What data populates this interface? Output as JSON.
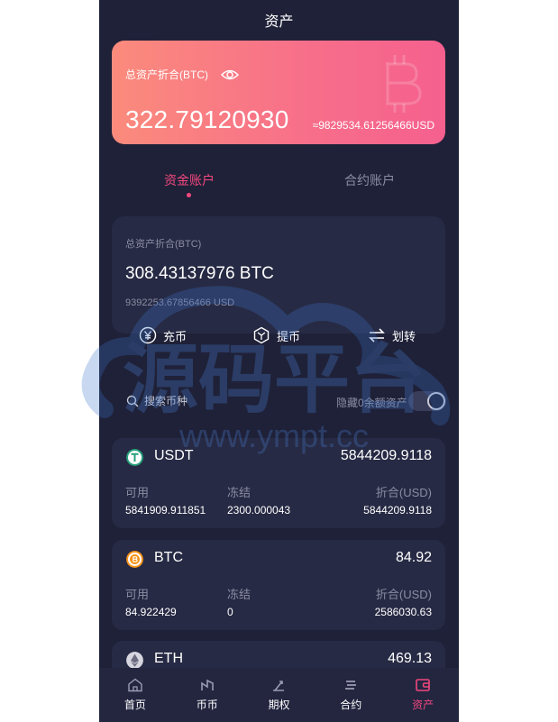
{
  "header": {
    "title": "资产"
  },
  "hero": {
    "label": "总资产折合(BTC)",
    "total": "322.79120930",
    "usd": "≈9829534.61256466USD",
    "eye_icon": "eye-icon"
  },
  "tabs": [
    {
      "label": "资金账户",
      "active": true
    },
    {
      "label": "合约账户",
      "active": false
    }
  ],
  "account": {
    "label": "总资产折合(BTC)",
    "btc": "308.43137976 BTC",
    "usd": "9392253.67856466 USD"
  },
  "actions": [
    {
      "label": "充币",
      "icon": "yen-circle-icon"
    },
    {
      "label": "提币",
      "icon": "hexagon-icon"
    },
    {
      "label": "划转",
      "icon": "transfer-icon"
    }
  ],
  "search": {
    "placeholder": "搜索币种",
    "hide_zero_label": "隐藏0余额资产"
  },
  "coins": [
    {
      "name": "USDT",
      "amount": "5844209.9118",
      "h_avail": "可用",
      "h_frozen": "冻结",
      "h_value": "折合(USD)",
      "avail": "5841909.911851",
      "frozen": "2300.000043",
      "value": "5844209.9118",
      "icon_color": "#26a17b"
    },
    {
      "name": "BTC",
      "amount": "84.92",
      "h_avail": "可用",
      "h_frozen": "冻结",
      "h_value": "折合(USD)",
      "avail": "84.922429",
      "frozen": "0",
      "value": "2586030.63",
      "icon_color": "#f7931a"
    },
    {
      "name": "ETH",
      "amount": "469.13"
    }
  ],
  "nav": [
    {
      "label": "首页",
      "icon": "home-icon",
      "active": false
    },
    {
      "label": "币币",
      "icon": "coin-trade-icon",
      "active": false
    },
    {
      "label": "期权",
      "icon": "option-icon",
      "active": false
    },
    {
      "label": "合约",
      "icon": "contract-icon",
      "active": false
    },
    {
      "label": "资产",
      "icon": "wallet-icon",
      "active": true
    }
  ],
  "watermark": {
    "text": "源码平台",
    "url": "www.ympt.cc"
  },
  "colors": {
    "accent": "#f2477d",
    "bg": "#1f2138",
    "card": "#272a44"
  }
}
